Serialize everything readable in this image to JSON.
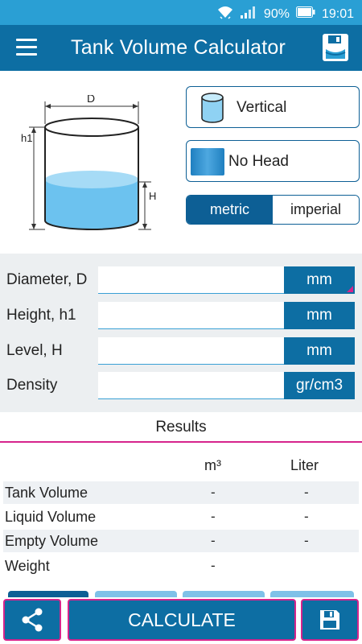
{
  "status_bar": {
    "battery_percent": "90%",
    "time": "19:01",
    "icons": [
      "wifi-icon",
      "signal-icon",
      "battery-icon"
    ]
  },
  "app_bar": {
    "title": "Tank Volume Calculator",
    "icons": [
      "menu-icon",
      "save-tank-icon"
    ]
  },
  "diagram": {
    "label_d": "D",
    "label_h1": "h1",
    "label_h": "H"
  },
  "options": {
    "orientation_label": "Vertical",
    "head_label": "No Head"
  },
  "units": {
    "metric_label": "metric",
    "imperial_label": "imperial",
    "selected": "metric"
  },
  "inputs": [
    {
      "label": "Diameter, D",
      "value": "",
      "unit": "mm"
    },
    {
      "label": "Height, h1",
      "value": "",
      "unit": "mm"
    },
    {
      "label": "Level, H",
      "value": "",
      "unit": "mm"
    },
    {
      "label": "Density",
      "value": "",
      "unit": "gr/cm3"
    }
  ],
  "results": {
    "title": "Results",
    "col_m3": "m³",
    "col_liter": "Liter",
    "rows": [
      {
        "name": "Tank Volume",
        "m3": "-",
        "liter": "-"
      },
      {
        "name": "Liquid Volume",
        "m3": "-",
        "liter": "-"
      },
      {
        "name": "Empty Volume",
        "m3": "-",
        "liter": "-"
      },
      {
        "name": "Weight",
        "m3": "-",
        "liter": ""
      }
    ]
  },
  "bottom_bar": {
    "calculate_label": "CALCULATE",
    "icons": [
      "share-icon",
      "save-icon"
    ]
  },
  "colors": {
    "status_bar": "#2a9fd4",
    "primary": "#0d6ea3",
    "accent": "#d6248c",
    "liquid": "#6cc2ef"
  }
}
